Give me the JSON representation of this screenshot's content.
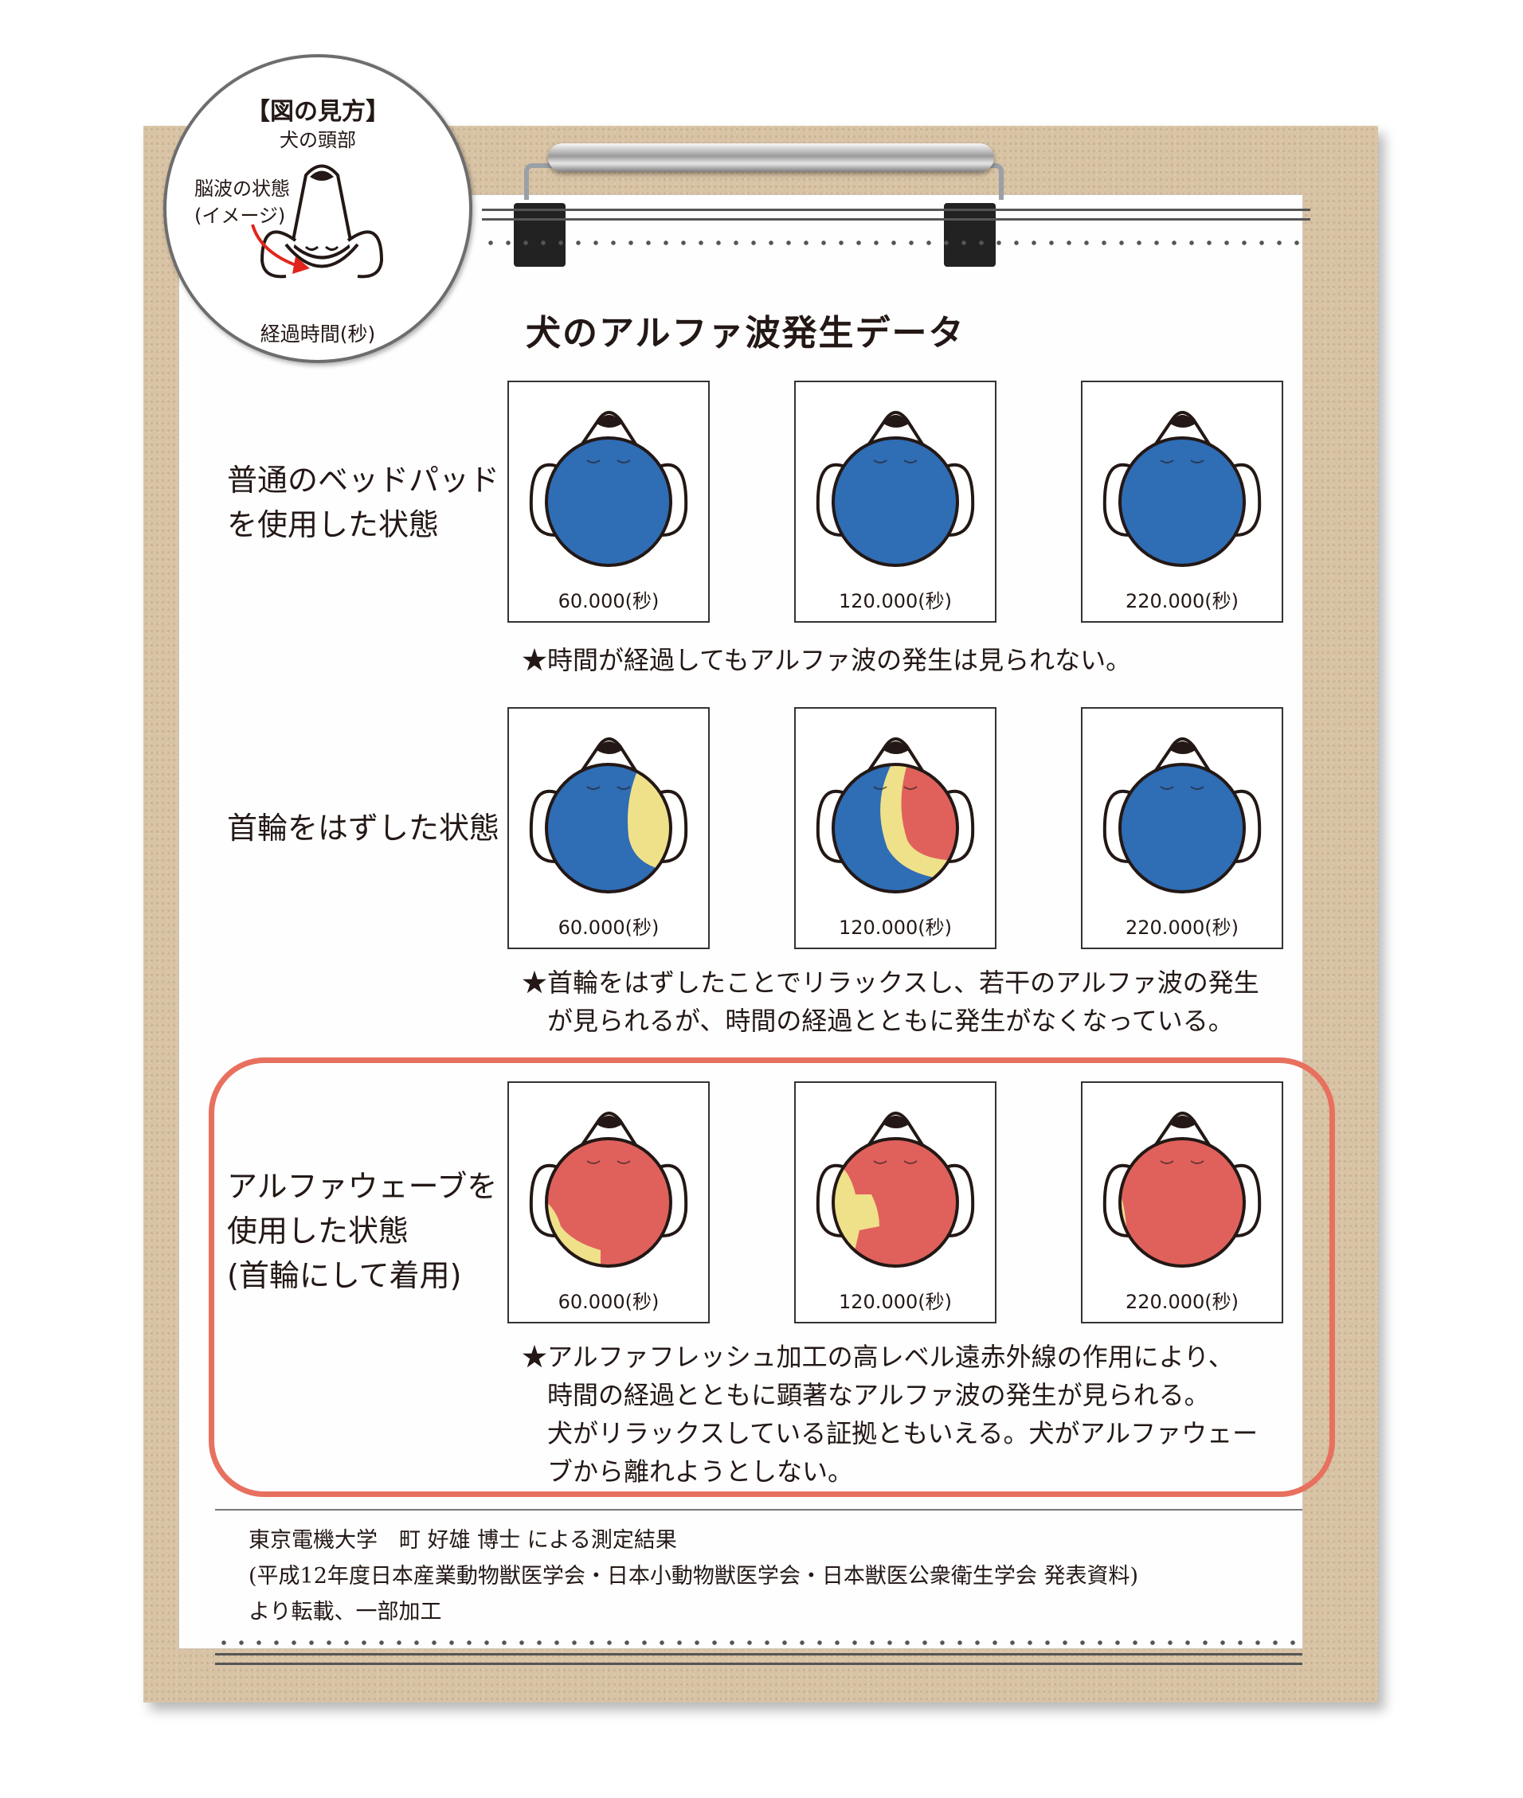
{
  "title": "犬のアルファ波発生データ",
  "legend": {
    "heading": "【図の見方】",
    "subheading": "犬の頭部",
    "brainwave_label_line1": "脳波の状態",
    "brainwave_label_line2": "(イメージ)",
    "elapsed_label": "経過時間(秒)"
  },
  "rows": [
    {
      "label_lines": [
        "普通のベッドパッド",
        "を使用した状態"
      ],
      "panels": [
        {
          "time": "60.000(秒)",
          "state": "blue"
        },
        {
          "time": "120.000(秒)",
          "state": "blue"
        },
        {
          "time": "220.000(秒)",
          "state": "blue"
        }
      ],
      "note_lines": [
        "★時間が経過してもアルファ波の発生は見られない。"
      ]
    },
    {
      "label_lines": [
        "首輪をはずした状態"
      ],
      "panels": [
        {
          "time": "60.000(秒)",
          "state": "blue-yellow"
        },
        {
          "time": "120.000(秒)",
          "state": "blue-red"
        },
        {
          "time": "220.000(秒)",
          "state": "blue"
        }
      ],
      "note_lines": [
        "★首輪をはずしたことでリラックスし、若干のアルファ波の発生",
        "　が見られるが、時間の経過とともに発生がなくなっている。"
      ]
    },
    {
      "label_lines": [
        "アルファウェーブを",
        "使用した状態",
        "(首輪にして着用)"
      ],
      "panels": [
        {
          "time": "60.000(秒)",
          "state": "red-yellow"
        },
        {
          "time": "120.000(秒)",
          "state": "red-yellow2"
        },
        {
          "time": "220.000(秒)",
          "state": "red-yellow3"
        }
      ],
      "note_lines": [
        "★アルファフレッシュ加工の高レベル遠赤外線の作用により、",
        "　時間の経過とともに顕著なアルファ波の発生が見られる。",
        "　犬がリラックスしている証拠ともいえる。犬がアルファウェー",
        "　ブから離れようとしない。"
      ]
    }
  ],
  "credits": [
    "東京電機大学　町 好雄 博士 による測定結果",
    "(平成12年度日本産業動物獣医学会・日本小動物獣医学会・日本獣医公衆衛生学会 発表資料)",
    "より転載、一部加工"
  ],
  "colors": {
    "blue": "#2f6db5",
    "red": "#e0615c",
    "yellow": "#efe08a",
    "highlight": "#e8705e"
  }
}
